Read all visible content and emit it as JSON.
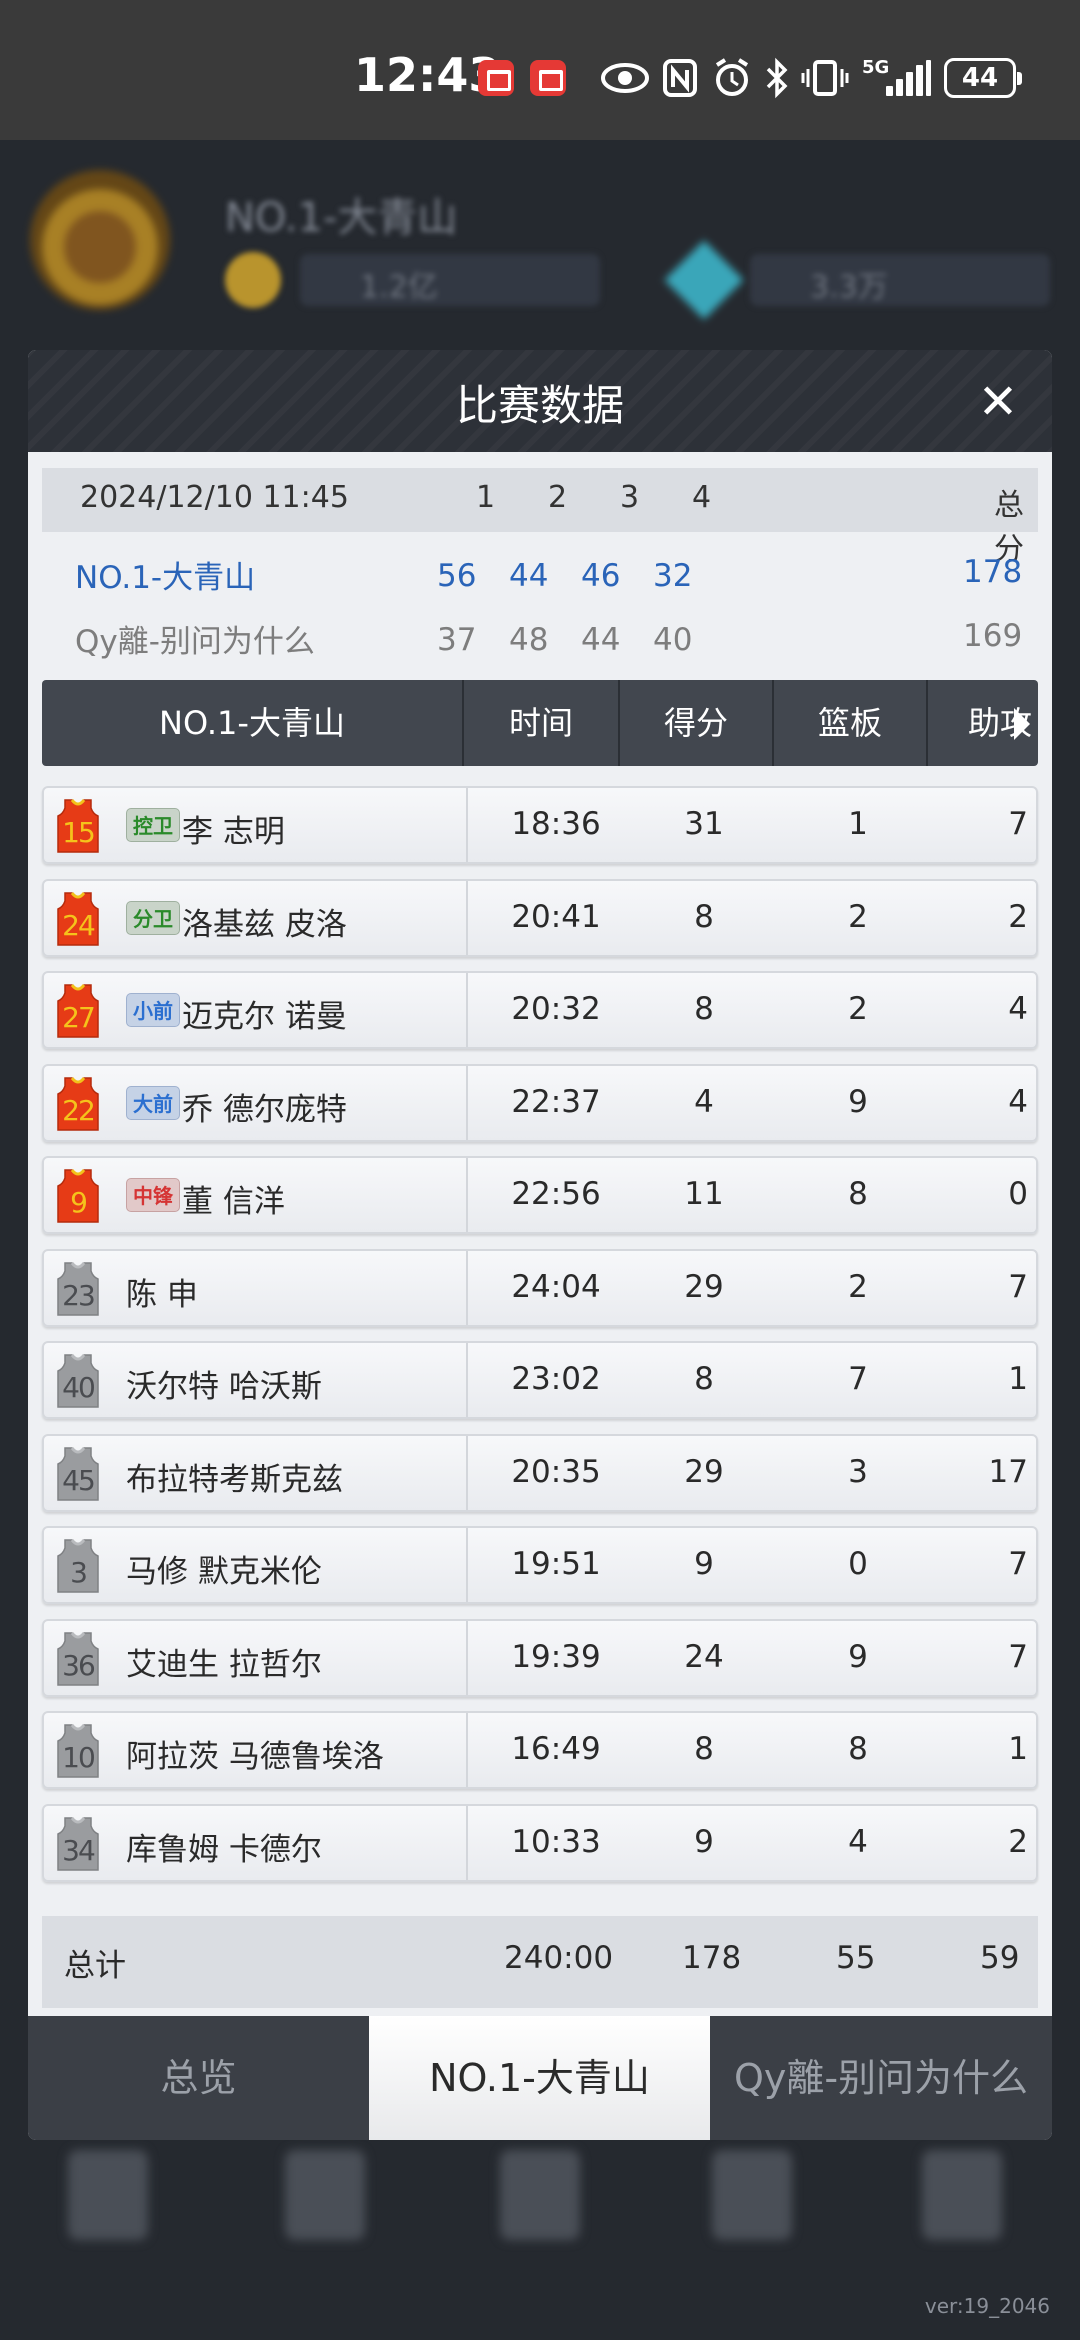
{
  "status_bar": {
    "time": "12:43",
    "network": "5G",
    "battery": "44"
  },
  "background": {
    "team_name": "NO.1-大青山",
    "coins": "1.2亿",
    "gems": "3.3万",
    "version": "ver:19_2046"
  },
  "modal": {
    "title": "比赛数据",
    "close_label": "✕"
  },
  "score_summary": {
    "datetime": "2024/12/10 11:45",
    "quarters": [
      "1",
      "2",
      "3",
      "4"
    ],
    "total_label": "总分",
    "team1": {
      "name": "NO.1-大青山",
      "q": [
        "56",
        "44",
        "46",
        "32"
      ],
      "total": "178",
      "color": "#2a64b8"
    },
    "team2": {
      "name": "Qy離-别问为什么",
      "q": [
        "37",
        "48",
        "44",
        "40"
      ],
      "total": "169",
      "color": "#7d7d7d"
    }
  },
  "table": {
    "team_header": "NO.1-大青山",
    "columns": [
      "时间",
      "得分",
      "篮板",
      "助攻"
    ],
    "players": [
      {
        "number": "15",
        "position": "控卫",
        "pos_color": "green",
        "name": "李 志明",
        "time": "18:36",
        "pts": "31",
        "reb": "1",
        "ast": "7",
        "starter": true
      },
      {
        "number": "24",
        "position": "分卫",
        "pos_color": "green",
        "name": "洛基兹 皮洛",
        "time": "20:41",
        "pts": "8",
        "reb": "2",
        "ast": "2",
        "starter": true
      },
      {
        "number": "27",
        "position": "小前",
        "pos_color": "blue",
        "name": "迈克尔 诺曼",
        "time": "20:32",
        "pts": "8",
        "reb": "2",
        "ast": "4",
        "starter": true
      },
      {
        "number": "22",
        "position": "大前",
        "pos_color": "blue",
        "name": "乔 德尔庞特",
        "time": "22:37",
        "pts": "4",
        "reb": "9",
        "ast": "4",
        "starter": true
      },
      {
        "number": "9",
        "position": "中锋",
        "pos_color": "red",
        "name": "董 信洋",
        "time": "22:56",
        "pts": "11",
        "reb": "8",
        "ast": "0",
        "starter": true
      },
      {
        "number": "23",
        "position": "",
        "name": "陈 申",
        "time": "24:04",
        "pts": "29",
        "reb": "2",
        "ast": "7",
        "starter": false
      },
      {
        "number": "40",
        "position": "",
        "name": "沃尔特 哈沃斯",
        "time": "23:02",
        "pts": "8",
        "reb": "7",
        "ast": "1",
        "starter": false
      },
      {
        "number": "45",
        "position": "",
        "name": "布拉特考斯克兹",
        "time": "20:35",
        "pts": "29",
        "reb": "3",
        "ast": "17",
        "starter": false
      },
      {
        "number": "3",
        "position": "",
        "name": "马修 默克米伦",
        "time": "19:51",
        "pts": "9",
        "reb": "0",
        "ast": "7",
        "starter": false
      },
      {
        "number": "36",
        "position": "",
        "name": "艾迪生 拉哲尔",
        "time": "19:39",
        "pts": "24",
        "reb": "9",
        "ast": "7",
        "starter": false
      },
      {
        "number": "10",
        "position": "",
        "name": "阿拉茨 马德鲁埃洛",
        "time": "16:49",
        "pts": "8",
        "reb": "8",
        "ast": "1",
        "starter": false
      },
      {
        "number": "34",
        "position": "",
        "name": "库鲁姆 卡德尔",
        "time": "10:33",
        "pts": "9",
        "reb": "4",
        "ast": "2",
        "starter": false
      }
    ],
    "totals": {
      "label": "总计",
      "time": "240:00",
      "pts": "178",
      "reb": "55",
      "ast": "59"
    }
  },
  "tabs": [
    {
      "label": "总览",
      "active": false
    },
    {
      "label": "NO.1-大青山",
      "active": true
    },
    {
      "label": "Qy離-别问为什么",
      "active": false
    }
  ]
}
